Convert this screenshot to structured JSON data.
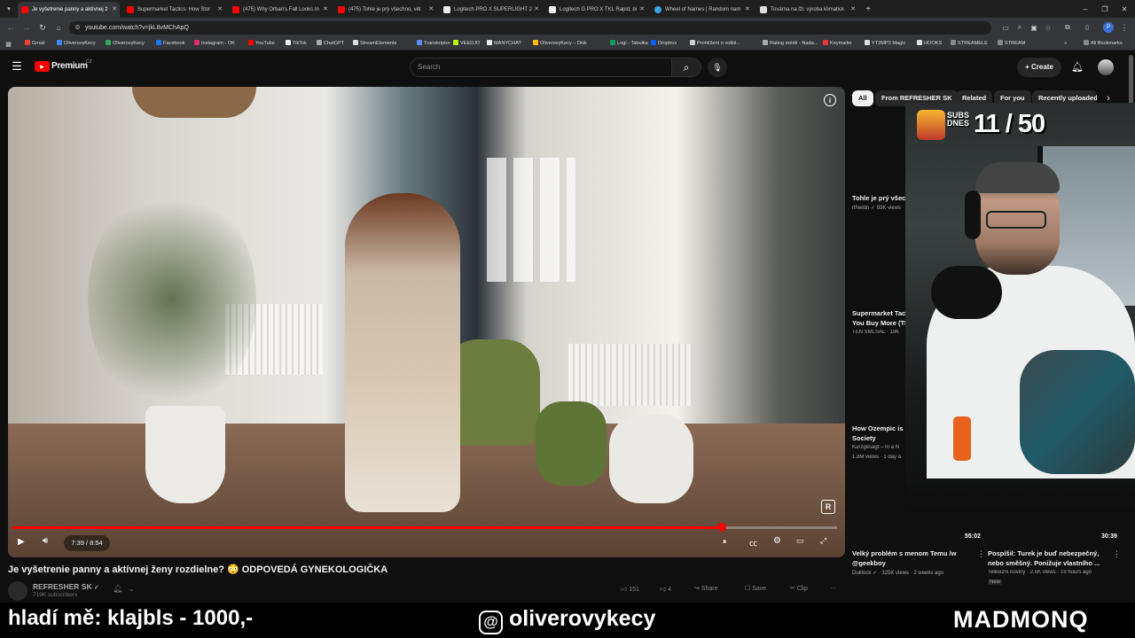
{
  "browser": {
    "tabs": [
      {
        "label": "Je vyšetrenie panny a aktívnej ž",
        "active": true,
        "color": "#ff0000"
      },
      {
        "label": "Supermarket Tactics: How Stor",
        "active": false,
        "color": "#ff0000"
      },
      {
        "label": "(475) Why Orban's Fall Looks In",
        "active": false,
        "color": "#ff0000"
      },
      {
        "label": "(475) Tohle je prý všechno, vět",
        "active": false,
        "color": "#ff0000"
      },
      {
        "label": "Logitech PRO X SUPERLIGHT 2",
        "active": false,
        "color": "#ffffff"
      },
      {
        "label": "Logitech G PRO X TKL Rapid, bi",
        "active": false,
        "color": "#ffffff"
      },
      {
        "label": "Wheel of Names | Random nam",
        "active": false,
        "color": "#3aa3e3"
      },
      {
        "label": "Továrna na lži: výroba klimatick",
        "active": false,
        "color": "#dddddd"
      }
    ],
    "url": "youtube.com/watch?v=jkL8vMChApQ",
    "bookmarks": [
      {
        "label": "Gmail",
        "color": "#ea4335"
      },
      {
        "label": "OliverovyKecy",
        "color": "#4285f4"
      },
      {
        "label": "OliverovyKecy",
        "color": "#34a853"
      },
      {
        "label": "Facebook",
        "color": "#1877f2"
      },
      {
        "label": "Instagram - OK",
        "color": "#e1306c"
      },
      {
        "label": "YouTube",
        "color": "#ff0000"
      },
      {
        "label": "TikTok",
        "color": "#eeeeee"
      },
      {
        "label": "ChatGPT",
        "color": "#aaaaaa"
      },
      {
        "label": "StreamElements",
        "color": "#dddddd"
      },
      {
        "label": "Transkriptor",
        "color": "#5b8cff"
      },
      {
        "label": "VEEDJO",
        "color": "#b6f500"
      },
      {
        "label": "MANYCHAT",
        "color": "#eeeeee"
      },
      {
        "label": "OliverovyKecy – Disk",
        "color": "#fbbc04"
      },
      {
        "label": "Logi - Tabulka",
        "color": "#0f9d58"
      },
      {
        "label": "Dropbox",
        "color": "#0061fe"
      },
      {
        "label": "Prohlížení o volbil...",
        "color": "#cccccc"
      },
      {
        "label": "Rating médií - Nada...",
        "color": "#aaaaaa"
      },
      {
        "label": "Keymailer",
        "color": "#e53935"
      },
      {
        "label": "YT2MP3 Magic",
        "color": "#dddddd"
      },
      {
        "label": "HOOKS",
        "color": "#dddddd"
      },
      {
        "label": "STREAMELE",
        "color": "#888888"
      },
      {
        "label": "STREAM",
        "color": "#888888"
      }
    ],
    "all_bookmarks": "All Bookmarks",
    "more": "»"
  },
  "youtube": {
    "logo_text": "Premium",
    "logo_sup": "CZ",
    "search_placeholder": "Search",
    "create_label": "Create"
  },
  "player": {
    "time": "7:39 / 8:54",
    "progress_fraction": 0.86
  },
  "video": {
    "title": "Je vyšetrenie panny a aktívnej ženy rozdielne? 😳 ODPOVEDÁ GYNEKOLOGIČKA",
    "channel": "REFRESHER SK",
    "subscribers": "719K subscribers",
    "likes": "151",
    "dislikes": "4",
    "share": "Share",
    "save": "Save",
    "clip": "Clip"
  },
  "sidebar": {
    "chips": [
      "All",
      "From REFRESHER SK",
      "Related",
      "For you",
      "Recently uploaded"
    ],
    "items": [
      {
        "title": "Tohle je prý všech",
        "meta": "rthwldn ✓ 93K views"
      },
      {
        "title": "Supermarket Tacti",
        "title2": "You Buy More (TI",
        "meta": "TEN SMLSAL · 19K"
      },
      {
        "title": "How Ozempic is C",
        "title2": "Society",
        "meta": "Kurzgesagt – In a N",
        "meta2": "1.8M views · 1 day a"
      }
    ]
  },
  "bottom_videos": [
    {
      "duration": "55:02",
      "title": "Velký problém s menom Temu /w",
      "title2": "@geekboy",
      "meta": "Duklock ✓ · 325K views · 2 weeks ago"
    },
    {
      "duration": "30:39",
      "title": "Pospíšil: Turek je buď nebezpečný,",
      "title2": "nebo směšný. Ponižuje vlastního ...",
      "meta": "Televizní noviny · 2.5K views · 19 hours ago",
      "meta2": "New"
    }
  ],
  "stream": {
    "subs_label": "SUBS DNES",
    "subs_count": "11 / 50",
    "donation": "hladí mě: klajbls - 1000,-",
    "handle": "oliverovykecy",
    "brand": "MADMONQ"
  }
}
